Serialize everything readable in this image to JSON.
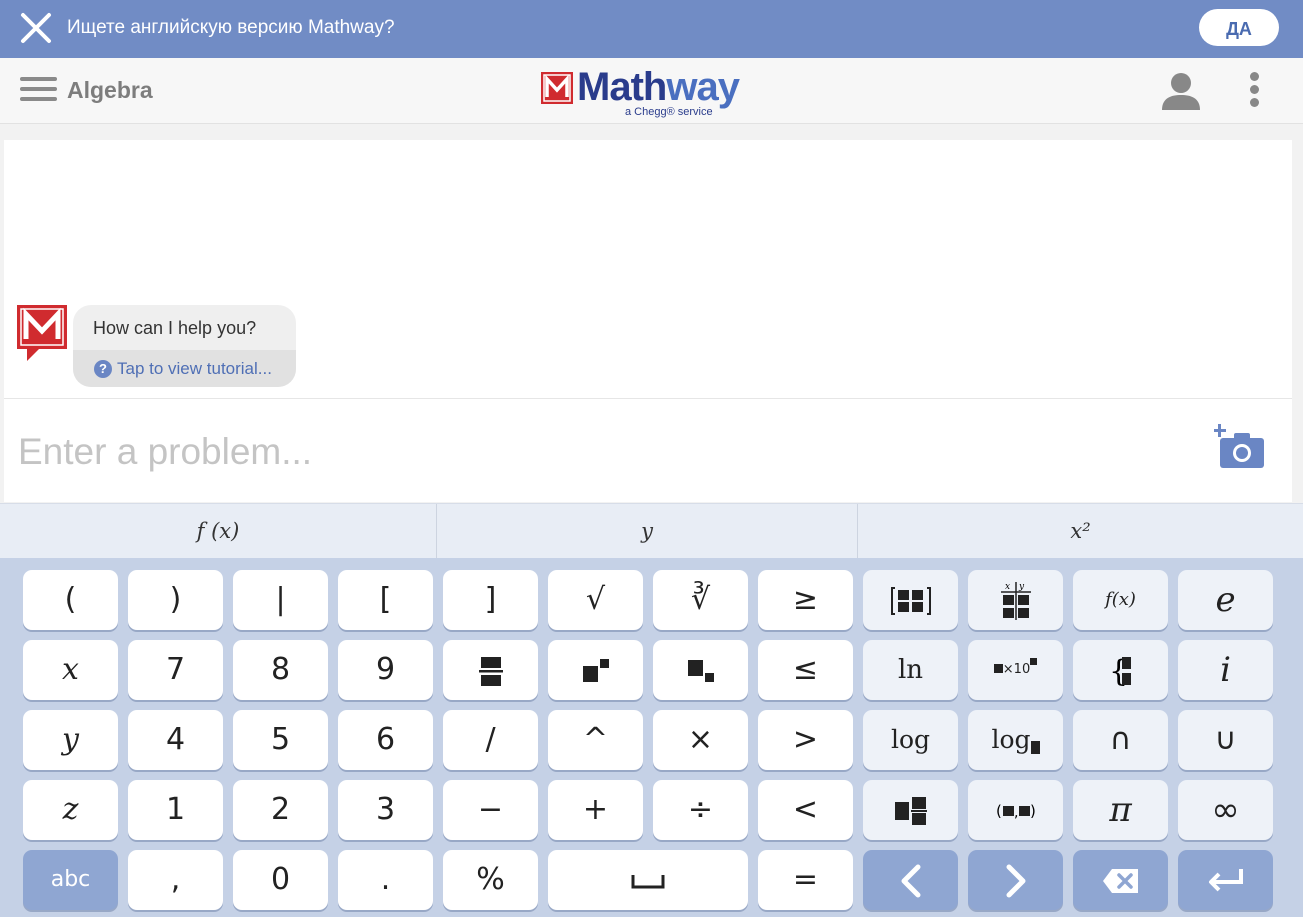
{
  "banner": {
    "message": "Ищете английскую версию Mathway?",
    "yes_label": "ДА"
  },
  "header": {
    "subject": "Algebra",
    "logo_text_1": "Math",
    "logo_text_2": "way",
    "logo_sub": "a Chegg® service"
  },
  "chat": {
    "greeting": "How can I help you?",
    "tutorial_link": "Tap to view tutorial...",
    "help_glyph": "?"
  },
  "input": {
    "placeholder": "Enter a problem..."
  },
  "tabs": [
    "f (x)",
    "y",
    "x²"
  ],
  "keys": {
    "row1": [
      "(",
      ")",
      "|",
      "[",
      "]",
      "√",
      "∛",
      "≥"
    ],
    "row2": [
      "x",
      "7",
      "8",
      "9",
      "fraction",
      "power",
      "subscript",
      "≤"
    ],
    "row3": [
      "y",
      "4",
      "5",
      "6",
      "/",
      "^",
      "×",
      ">"
    ],
    "row4": [
      "z",
      "1",
      "2",
      "3",
      "−",
      "+",
      "÷",
      "<"
    ],
    "row5": [
      "abc",
      ",",
      "0",
      ".",
      "%",
      "␣",
      "="
    ],
    "func": {
      "fx": "f(x)",
      "e": "e",
      "ln": "ln",
      "sci": "×10",
      "i": "i",
      "log": "log",
      "logb": "log",
      "cap": "∩",
      "cup": "∪",
      "pi": "π",
      "inf": "∞",
      "matrix2": "matrix",
      "xy": "x | y"
    }
  },
  "colors": {
    "banner": "#718cc5",
    "keypad": "#c5d1e6",
    "accent": "#4a6fc0",
    "brand_red": "#d02b2f"
  },
  "icons": {
    "close": "close-icon",
    "menu": "hamburger-icon",
    "user": "user-icon",
    "more": "more-vertical-icon",
    "camera": "camera-icon",
    "backspace": "backspace-icon",
    "enter": "enter-icon",
    "left": "arrow-left-icon",
    "right": "arrow-right-icon"
  }
}
